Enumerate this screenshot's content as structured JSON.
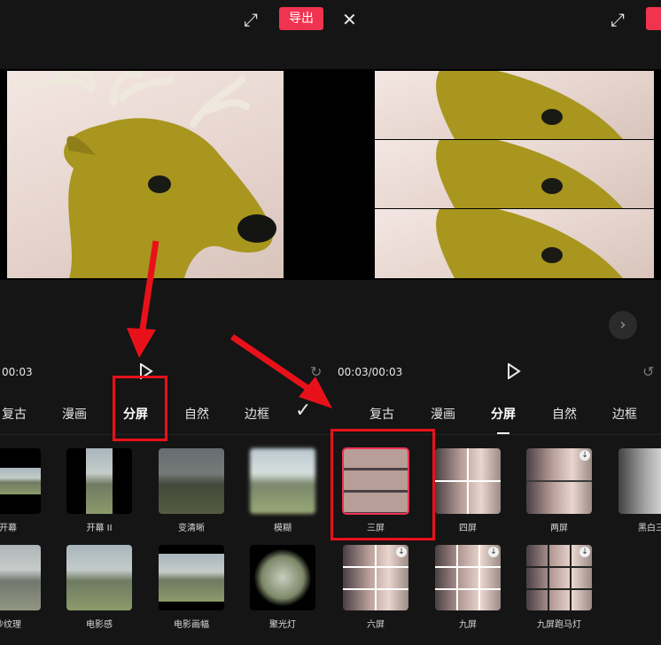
{
  "export_label": "导出",
  "left": {
    "time": "00:03",
    "tabs": [
      "复古",
      "漫画",
      "分屏",
      "自然",
      "边框"
    ],
    "effects_row1": [
      "开幕",
      "开幕 II",
      "变清晰",
      "模糊"
    ],
    "effects_row2": [
      "沙纹理",
      "电影感",
      "电影画幅",
      "聚光灯"
    ]
  },
  "right": {
    "time": "00:03/00:03",
    "tabs": [
      "复古",
      "漫画",
      "分屏",
      "自然",
      "边框"
    ],
    "effects_row1": [
      "三屏",
      "四屏",
      "两屏",
      "黑白三"
    ],
    "effects_row2": [
      "六屏",
      "九屏",
      "九屏跑马灯"
    ]
  },
  "icons": {
    "fullscreen": "fullscreen-icon",
    "close": "close-icon",
    "play": "play-icon",
    "undo": "undo-icon",
    "redo": "redo-icon",
    "confirm": "check-icon",
    "next": "chevron-right-icon",
    "download": "download-icon"
  },
  "accent": "#f0334f",
  "annotation_color": "#e8111a"
}
